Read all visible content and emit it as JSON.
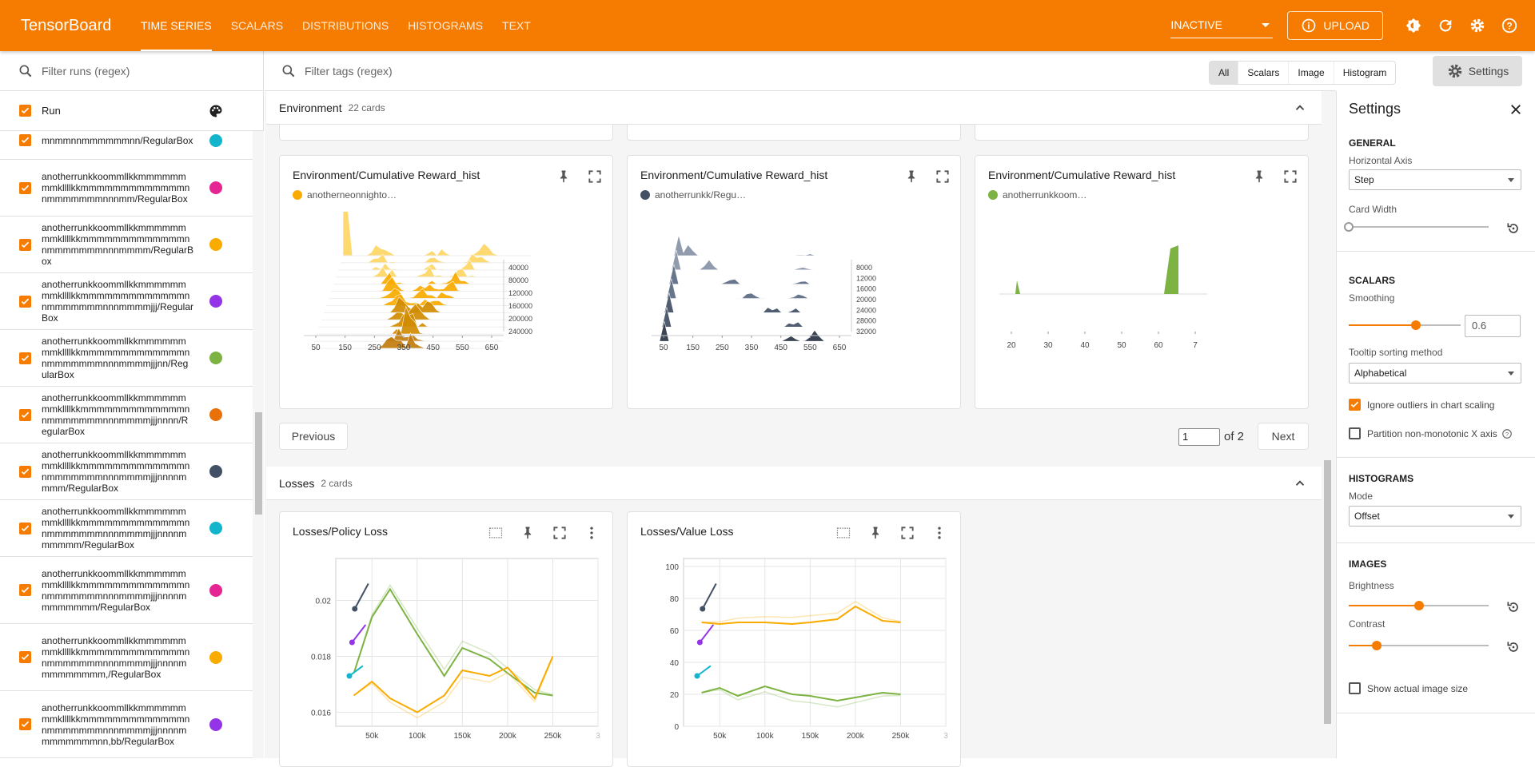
{
  "app": {
    "brand": "TensorBoard"
  },
  "nav": {
    "tabs": [
      {
        "label": "TIME SERIES"
      },
      {
        "label": "SCALARS"
      },
      {
        "label": "DISTRIBUTIONS"
      },
      {
        "label": "HISTOGRAMS"
      },
      {
        "label": "TEXT"
      }
    ]
  },
  "toolbar": {
    "status": "INACTIVE",
    "upload": "UPLOAD"
  },
  "runs": {
    "filter_placeholder": "Filter runs (regex)",
    "header": "Run",
    "items": [
      {
        "name": "mnmmnnmmmmmmnn/RegularBox",
        "color": "#12b5cb"
      },
      {
        "name": "anotherrunkkoommllkkmmmmmmmmkllllkkmmmmmmmmmmmmmnnmmmmmmmnnnmm/RegularBox",
        "color": "#e52592"
      },
      {
        "name": "anotherrunkkoommllkkmmmmmmmmkllllkkmmmmmmmmmmmmmnnmmmmmmmnnnmmmm/RegularBox",
        "color": "#f9ab00"
      },
      {
        "name": "anotherrunkkoommllkkmmmmmmmmkllllkkmmmmmmmmmmmmmnnmmmmmmmnnnmmmmjjj/RegularBox",
        "color": "#9334e6"
      },
      {
        "name": "anotherrunkkoommllkkmmmmmmmmkllllkkmmmmmmmmmmmmmnnmmmmmmmnnnmmmmjjjnn/RegularBox",
        "color": "#7cb342"
      },
      {
        "name": "anotherrunkkoommllkkmmmmmmmmkllllkkmmmmmmmmmmmmmnnmmmmmmmnnnmmmmjjjnnnn/RegularBox",
        "color": "#e8710a"
      },
      {
        "name": "anotherrunkkoommllkkmmmmmmmmkllllkkmmmmmmmmmmmmmnnmmmmmmmnnnmmmmjjjnnnnmmmm/RegularBox",
        "color": "#425066"
      },
      {
        "name": "anotherrunkkoommllkkmmmmmmmmkllllkkmmmmmmmmmmmmmnnmmmmmmmnnnmmmmjjjnnnnmmmmmm/RegularBox",
        "color": "#12b5cb"
      },
      {
        "name": "anotherrunkkoommllkkmmmmmmmmkllllkkmmmmmmmmmmmmmnnmmmmmmmnnnmmmmjjjnnnnmmmmmmmm/RegularBox",
        "color": "#e52592"
      },
      {
        "name": "anotherrunkkoommllkkmmmmmmmmkllllkkmmmmmmmmmmmmmnnmmmmmmmnnnmmmmjjjnnnnmmmmmmmmm,/RegularBox",
        "color": "#f9ab00"
      },
      {
        "name": "anotherrunkkoommllkkmmmmmmmmkllllkkmmmmmmmmmmmmmnnmmmmmmmnnnmmmmjjjnnnnmmmmmmmmnn,bb/RegularBox",
        "color": "#9334e6"
      }
    ]
  },
  "tags": {
    "filter_placeholder": "Filter tags (regex)",
    "filters": [
      "All",
      "Scalars",
      "Image",
      "Histogram"
    ],
    "settings_button": "Settings"
  },
  "groups": {
    "environment": {
      "name": "Environment",
      "count": "22 cards",
      "cards": [
        {
          "title": "Environment/Cumulative Reward_hist",
          "run": "anotherneonnighto…",
          "color": "#f9ab00",
          "xticks": [
            "50",
            "150",
            "250",
            "350",
            "450",
            "550",
            "650"
          ],
          "yticks": [
            "40000",
            "80000",
            "120000",
            "160000",
            "200000",
            "240000"
          ]
        },
        {
          "title": "Environment/Cumulative Reward_hist",
          "run": "anotherrunkk/Regu…",
          "color": "#425066",
          "xticks": [
            "50",
            "150",
            "250",
            "350",
            "450",
            "550",
            "650"
          ],
          "yticks": [
            "8000",
            "12000",
            "16000",
            "20000",
            "24000",
            "28000",
            "32000"
          ]
        },
        {
          "title": "Environment/Cumulative Reward_hist",
          "run": "anotherrunkkoom…",
          "color": "#7cb342",
          "xticks": [
            "20",
            "30",
            "40",
            "50",
            "60",
            "7"
          ],
          "yticks": []
        }
      ],
      "pager": {
        "previous": "Previous",
        "page": "1",
        "of": "of 2",
        "next": "Next"
      }
    },
    "losses": {
      "name": "Losses",
      "count": "2 cards",
      "cards": [
        {
          "title": "Losses/Policy Loss"
        },
        {
          "title": "Losses/Value Loss"
        }
      ]
    }
  },
  "chart_data": [
    {
      "type": "line",
      "title": "Losses/Policy Loss",
      "x": [
        30000,
        50000,
        70000,
        100000,
        130000,
        150000,
        180000,
        200000,
        230000,
        250000
      ],
      "xticks": [
        "50k",
        "100k",
        "150k",
        "200k",
        "250k",
        "3"
      ],
      "yticks": [
        "0.02",
        "0.018",
        "0.016"
      ],
      "ylim": [
        0.0155,
        0.0215
      ],
      "series": [
        {
          "values": [
            0.0174,
            0.0194,
            0.0204,
            0.0188,
            0.0173,
            0.0183,
            0.0179,
            0.0174,
            0.0167,
            0.0166
          ],
          "color": "#7cb342"
        },
        {
          "values": [
            0.0166,
            0.0171,
            0.0165,
            0.016,
            0.0166,
            0.0175,
            0.0173,
            0.0176,
            0.0165,
            0.018
          ],
          "color": "#f9ab00"
        }
      ]
    },
    {
      "type": "line",
      "title": "Losses/Value Loss",
      "x": [
        30000,
        50000,
        70000,
        100000,
        130000,
        150000,
        180000,
        200000,
        230000,
        250000
      ],
      "xticks": [
        "50k",
        "100k",
        "150k",
        "200k",
        "250k",
        "3"
      ],
      "yticks": [
        "100",
        "80",
        "60",
        "40",
        "20",
        "0"
      ],
      "ylim": [
        0,
        105
      ],
      "series": [
        {
          "values": [
            65,
            64,
            65,
            65,
            64,
            65,
            67,
            75,
            66,
            65
          ],
          "color": "#f9ab00"
        },
        {
          "values": [
            21,
            24,
            19,
            25,
            20,
            19,
            16,
            18,
            21,
            20
          ],
          "color": "#7cb342"
        }
      ]
    }
  ],
  "settings": {
    "title": "Settings",
    "general": {
      "section": "GENERAL",
      "horizontal_axis_label": "Horizontal Axis",
      "horizontal_axis_value": "Step",
      "card_width_label": "Card Width"
    },
    "scalars": {
      "section": "SCALARS",
      "smoothing_label": "Smoothing",
      "smoothing_value": "0.6",
      "smoothing": 0.6,
      "tooltip_label": "Tooltip sorting method",
      "tooltip_value": "Alphabetical",
      "ignore_outliers": "Ignore outliers in chart scaling",
      "partition": "Partition non-monotonic X axis"
    },
    "histograms": {
      "section": "HISTOGRAMS",
      "mode_label": "Mode",
      "mode_value": "Offset"
    },
    "images": {
      "section": "IMAGES",
      "brightness_label": "Brightness",
      "brightness": 0.5,
      "contrast_label": "Contrast",
      "contrast": 0.2,
      "actual_size": "Show actual image size"
    }
  }
}
